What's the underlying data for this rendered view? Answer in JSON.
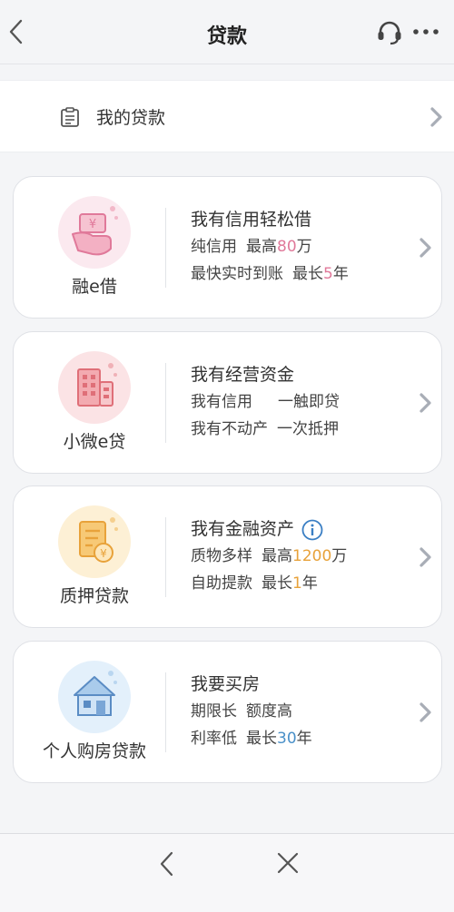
{
  "header": {
    "title": "贷款",
    "back_icon": "chevron-left-icon",
    "service_icon": "headset-icon",
    "more_icon": "more-dots-icon"
  },
  "my_loan": {
    "label": "我的贷款",
    "icon": "clipboard-icon"
  },
  "colors": {
    "pink": "#e0799a",
    "orange": "#e8a23a",
    "blue": "#4a90c8",
    "chevron": "#a8adb6"
  },
  "products": [
    {
      "name": "融e借",
      "icon": "hand-yuan-icon",
      "line1": "我有信用轻松借",
      "line2": {
        "a": "纯信用",
        "b": "最高",
        "hl": "80",
        "c": "万"
      },
      "line3": {
        "a": "最快实时到账",
        "b": "最长",
        "hl": "5",
        "c": "年"
      }
    },
    {
      "name": "小微e贷",
      "icon": "building-icon",
      "line1": "我有经营资金",
      "line2": {
        "a": "我有信用",
        "b": "一触即贷"
      },
      "line3": {
        "a": "我有不动产",
        "b": "一次抵押"
      }
    },
    {
      "name": "质押贷款",
      "icon": "document-coin-icon",
      "line1": "我有金融资产",
      "info_icon": "info-icon",
      "line2": {
        "a": "质物多样",
        "b": "最高",
        "hl": "1200",
        "c": "万"
      },
      "line3": {
        "a": "自助提款",
        "b": "最长",
        "hl": "1",
        "c": "年"
      }
    },
    {
      "name": "个人购房贷款",
      "icon": "house-icon",
      "line1": "我要买房",
      "line2": {
        "a": "期限长",
        "b": "额度高"
      },
      "line3": {
        "a": "利率低",
        "b": "最长",
        "hl": "30",
        "c": "年"
      }
    }
  ],
  "bottom_bar": {
    "back_icon": "chevron-left-icon",
    "close_icon": "close-icon"
  }
}
